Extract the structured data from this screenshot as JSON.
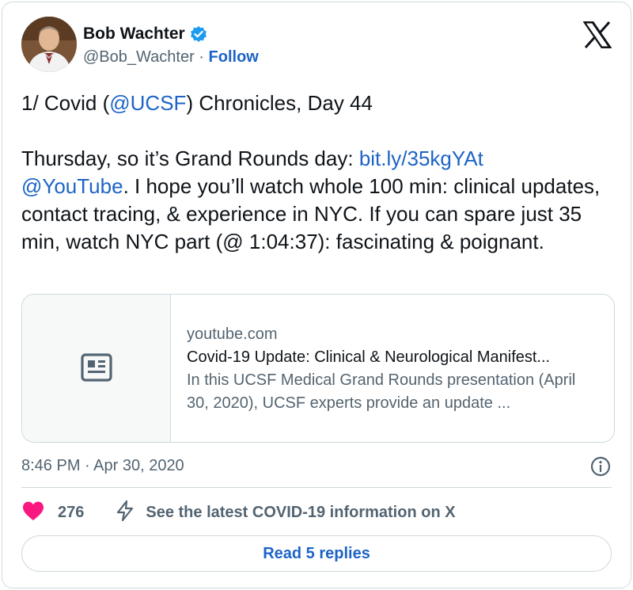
{
  "author": {
    "display_name": "Bob Wachter",
    "handle": "@Bob_Wachter",
    "separator": " · ",
    "follow_label": "Follow"
  },
  "tweet": {
    "line1_prefix": "1/ Covid (",
    "line1_mention": "@UCSF",
    "line1_suffix": ") Chronicles, Day 44",
    "para2_prefix": "Thursday, so it’s Grand Rounds day: ",
    "para2_link": "bit.ly/35kgYAt",
    "para2_mention": "@YouTube",
    "para2_suffix": ". I hope you’ll watch whole 100 min: clinical updates, contact tracing, & experience in NYC. If you can spare just 35 min, watch NYC part (@ 1:04:37): fascinating & poignant."
  },
  "link_card": {
    "domain": "youtube.com",
    "title": "Covid-19 Update: Clinical & Neurological Manifest...",
    "description": "In this UCSF Medical Grand Rounds presentation (April 30, 2020), UCSF experts provide an update ..."
  },
  "timestamp": "8:46 PM · Apr 30, 2020",
  "actions": {
    "like_count": "276",
    "covid_info_label": "See the latest COVID-19 information on X"
  },
  "replies_button_label": "Read 5 replies",
  "colors": {
    "link": "#1d64c6",
    "heart": "#f91880",
    "verified": "#1d9bf0",
    "secondary_text": "#536471",
    "border": "#cfd9de"
  }
}
